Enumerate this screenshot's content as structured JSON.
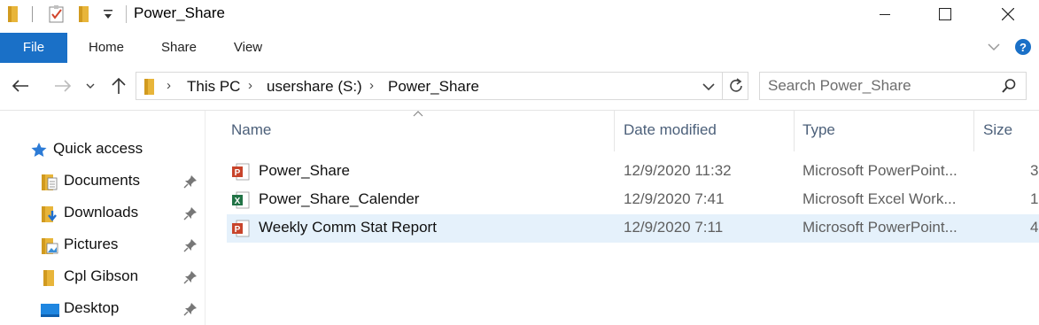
{
  "window": {
    "title": "Power_Share",
    "minimize_glyph": "—",
    "maximize_glyph": "☐",
    "close_glyph": "✕"
  },
  "ribbon": {
    "tabs": [
      "File",
      "Home",
      "Share",
      "View"
    ]
  },
  "address": {
    "crumbs": [
      "This PC",
      "usershare (S:)",
      "Power_Share"
    ]
  },
  "search": {
    "placeholder": "Search Power_Share"
  },
  "sidebar": {
    "quick_access": "Quick access",
    "items": [
      {
        "label": "Documents",
        "icon": "documents-folder-icon"
      },
      {
        "label": "Downloads",
        "icon": "downloads-folder-icon"
      },
      {
        "label": "Pictures",
        "icon": "pictures-folder-icon"
      },
      {
        "label": "Cpl Gibson",
        "icon": "folder-icon"
      },
      {
        "label": "Desktop",
        "icon": "desktop-icon"
      }
    ]
  },
  "columns": {
    "name": "Name",
    "date": "Date modified",
    "type": "Type",
    "size": "Size"
  },
  "files": [
    {
      "name": "Power_Share",
      "date": "12/9/2020 11:32",
      "type": "Microsoft PowerPoint...",
      "size": "3",
      "icon": "powerpoint-file-icon",
      "selected": false
    },
    {
      "name": "Power_Share_Calender",
      "date": "12/9/2020 7:41",
      "type": "Microsoft Excel Work...",
      "size": "1",
      "icon": "excel-file-icon",
      "selected": false
    },
    {
      "name": "Weekly Comm Stat Report",
      "date": "12/9/2020 7:11",
      "type": "Microsoft PowerPoint...",
      "size": "4",
      "icon": "powerpoint-file-icon",
      "selected": true
    }
  ],
  "colors": {
    "accent": "#1a70c7",
    "selection": "#e5f1fb",
    "folder": "#e8b53a",
    "powerpoint": "#c8442b",
    "excel": "#217346"
  }
}
